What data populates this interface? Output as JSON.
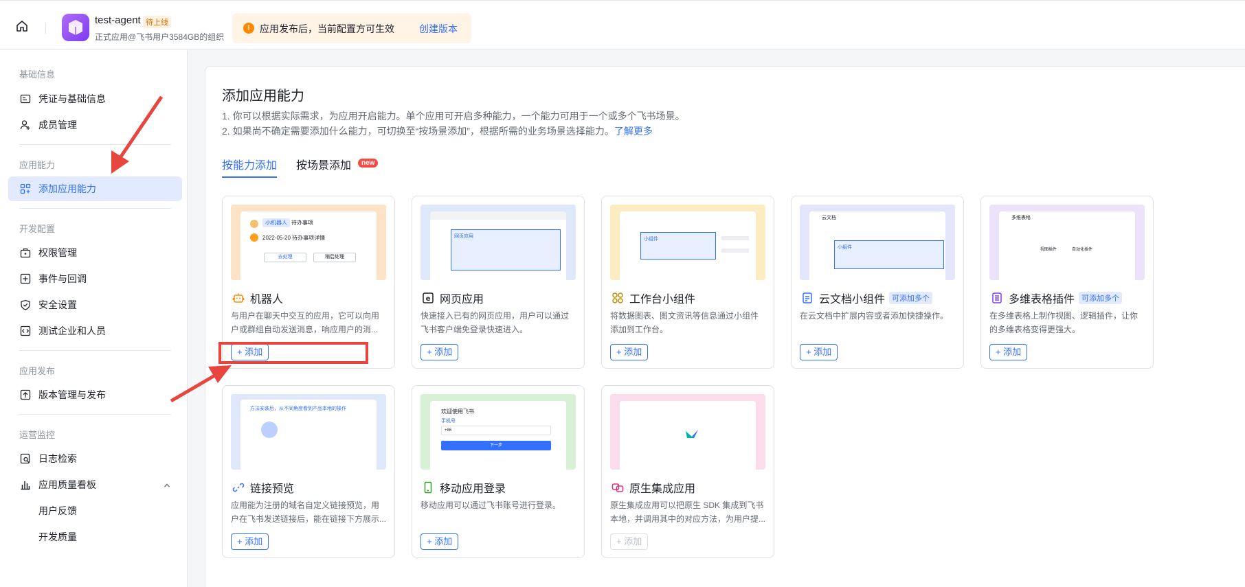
{
  "header": {
    "app_name": "test-agent",
    "app_status": "待上线",
    "app_subtitle": "正式应用@飞书用户3584GB的组织",
    "notice_text": "应用发布后，当前配置方可生效",
    "notice_link": "创建版本"
  },
  "sidebar": {
    "sections": [
      {
        "title": "基础信息"
      },
      {
        "title": "应用能力"
      },
      {
        "title": "开发配置"
      },
      {
        "title": "应用发布"
      },
      {
        "title": "运营监控"
      }
    ],
    "items": {
      "credentials": "凭证与基础信息",
      "members": "成员管理",
      "add_capability": "添加应用能力",
      "permissions": "权限管理",
      "events": "事件与回调",
      "security": "安全设置",
      "test_enterprise": "测试企业和人员",
      "version": "版本管理与发布",
      "logs": "日志检索",
      "quality": "应用质量看板",
      "feedback": "用户反馈",
      "dev_quality": "开发质量"
    }
  },
  "main": {
    "title": "添加应用能力",
    "desc1": "1. 你可以根据实际需求，为应用开启能力。单个应用可开启多种能力，一个能力可用于一个或多个飞书场景。",
    "desc2": "2. 如果尚不确定需要添加什么能力，可切换至“按场景添加”，根据所需的业务场景选择能力。",
    "desc2_link": "了解更多",
    "tabs": [
      {
        "label": "按能力添加"
      },
      {
        "label": "按场景添加"
      }
    ],
    "tab_new_badge": "new",
    "cards": [
      {
        "title": "机器人",
        "desc": "与用户在聊天中交互的应用，它可以向用户或群组自动发送消息，响应用户的消...",
        "button": "+ 添加",
        "thumb_color": "#fde3c6"
      },
      {
        "title": "网页应用",
        "desc": "快速接入已有的网页应用，用户可以通过飞书客户端免登录快速进入。",
        "button": "+ 添加",
        "thumb_color": "#dfe8fb"
      },
      {
        "title": "工作台小组件",
        "desc": "将数据图表、图文资讯等信息通过小组件添加到工作台。",
        "button": "+ 添加",
        "thumb_color": "#fbecc2"
      },
      {
        "title": "云文档小组件",
        "tag": "可添加多个",
        "desc": "在云文档中扩展内容或者添加快捷操作。",
        "button": "+ 添加",
        "thumb_color": "#e3e6fa"
      },
      {
        "title": "多维表格插件",
        "tag": "可添加多个",
        "desc": "在多维表格上制作视图、逻辑插件，让你的多维表格变得更强大。",
        "button": "+ 添加",
        "thumb_color": "#ece3fb"
      },
      {
        "title": "链接预览",
        "desc": "应用能为注册的域名自定义链接预览，用户在飞书发送链接后，能在链接下方展示...",
        "button": "+ 添加",
        "thumb_color": "#dfe8fb"
      },
      {
        "title": "移动应用登录",
        "desc": "移动应用可以通过飞书账号进行登录。",
        "button": "+ 添加",
        "thumb_color": "#d7f0d6"
      },
      {
        "title": "原生集成应用",
        "desc": "原生集成应用可以把原生 SDK 集成到飞书本地，并调用其中的对应方法，为用户提...",
        "button": "+ 添加",
        "thumb_color": "#fbdcea"
      }
    ],
    "thumb_texts": {
      "robot_name": "小机器人",
      "robot_todo": "待办事项",
      "robot_date": "2022-05-20 待办事项详情",
      "robot_btn1": "去处理",
      "robot_btn2": "稍后处理",
      "web_tab": "网页应用",
      "widget_label": "小组件",
      "doc_title": "云文档",
      "doc_label": "小组件",
      "bitable_title": "多维表格",
      "bitable_plugin1": "视图插件",
      "bitable_plugin2": "自动化插件",
      "link_hint": "方法安装后，从不同角度看到产品本地的操作",
      "mobile_title": "欢迎使用飞书",
      "mobile_tab": "手机号",
      "mobile_code": "+86",
      "mobile_btn": "下一步"
    }
  },
  "colors": {
    "accent": "#3370ff",
    "highlight": "#e8453f"
  }
}
